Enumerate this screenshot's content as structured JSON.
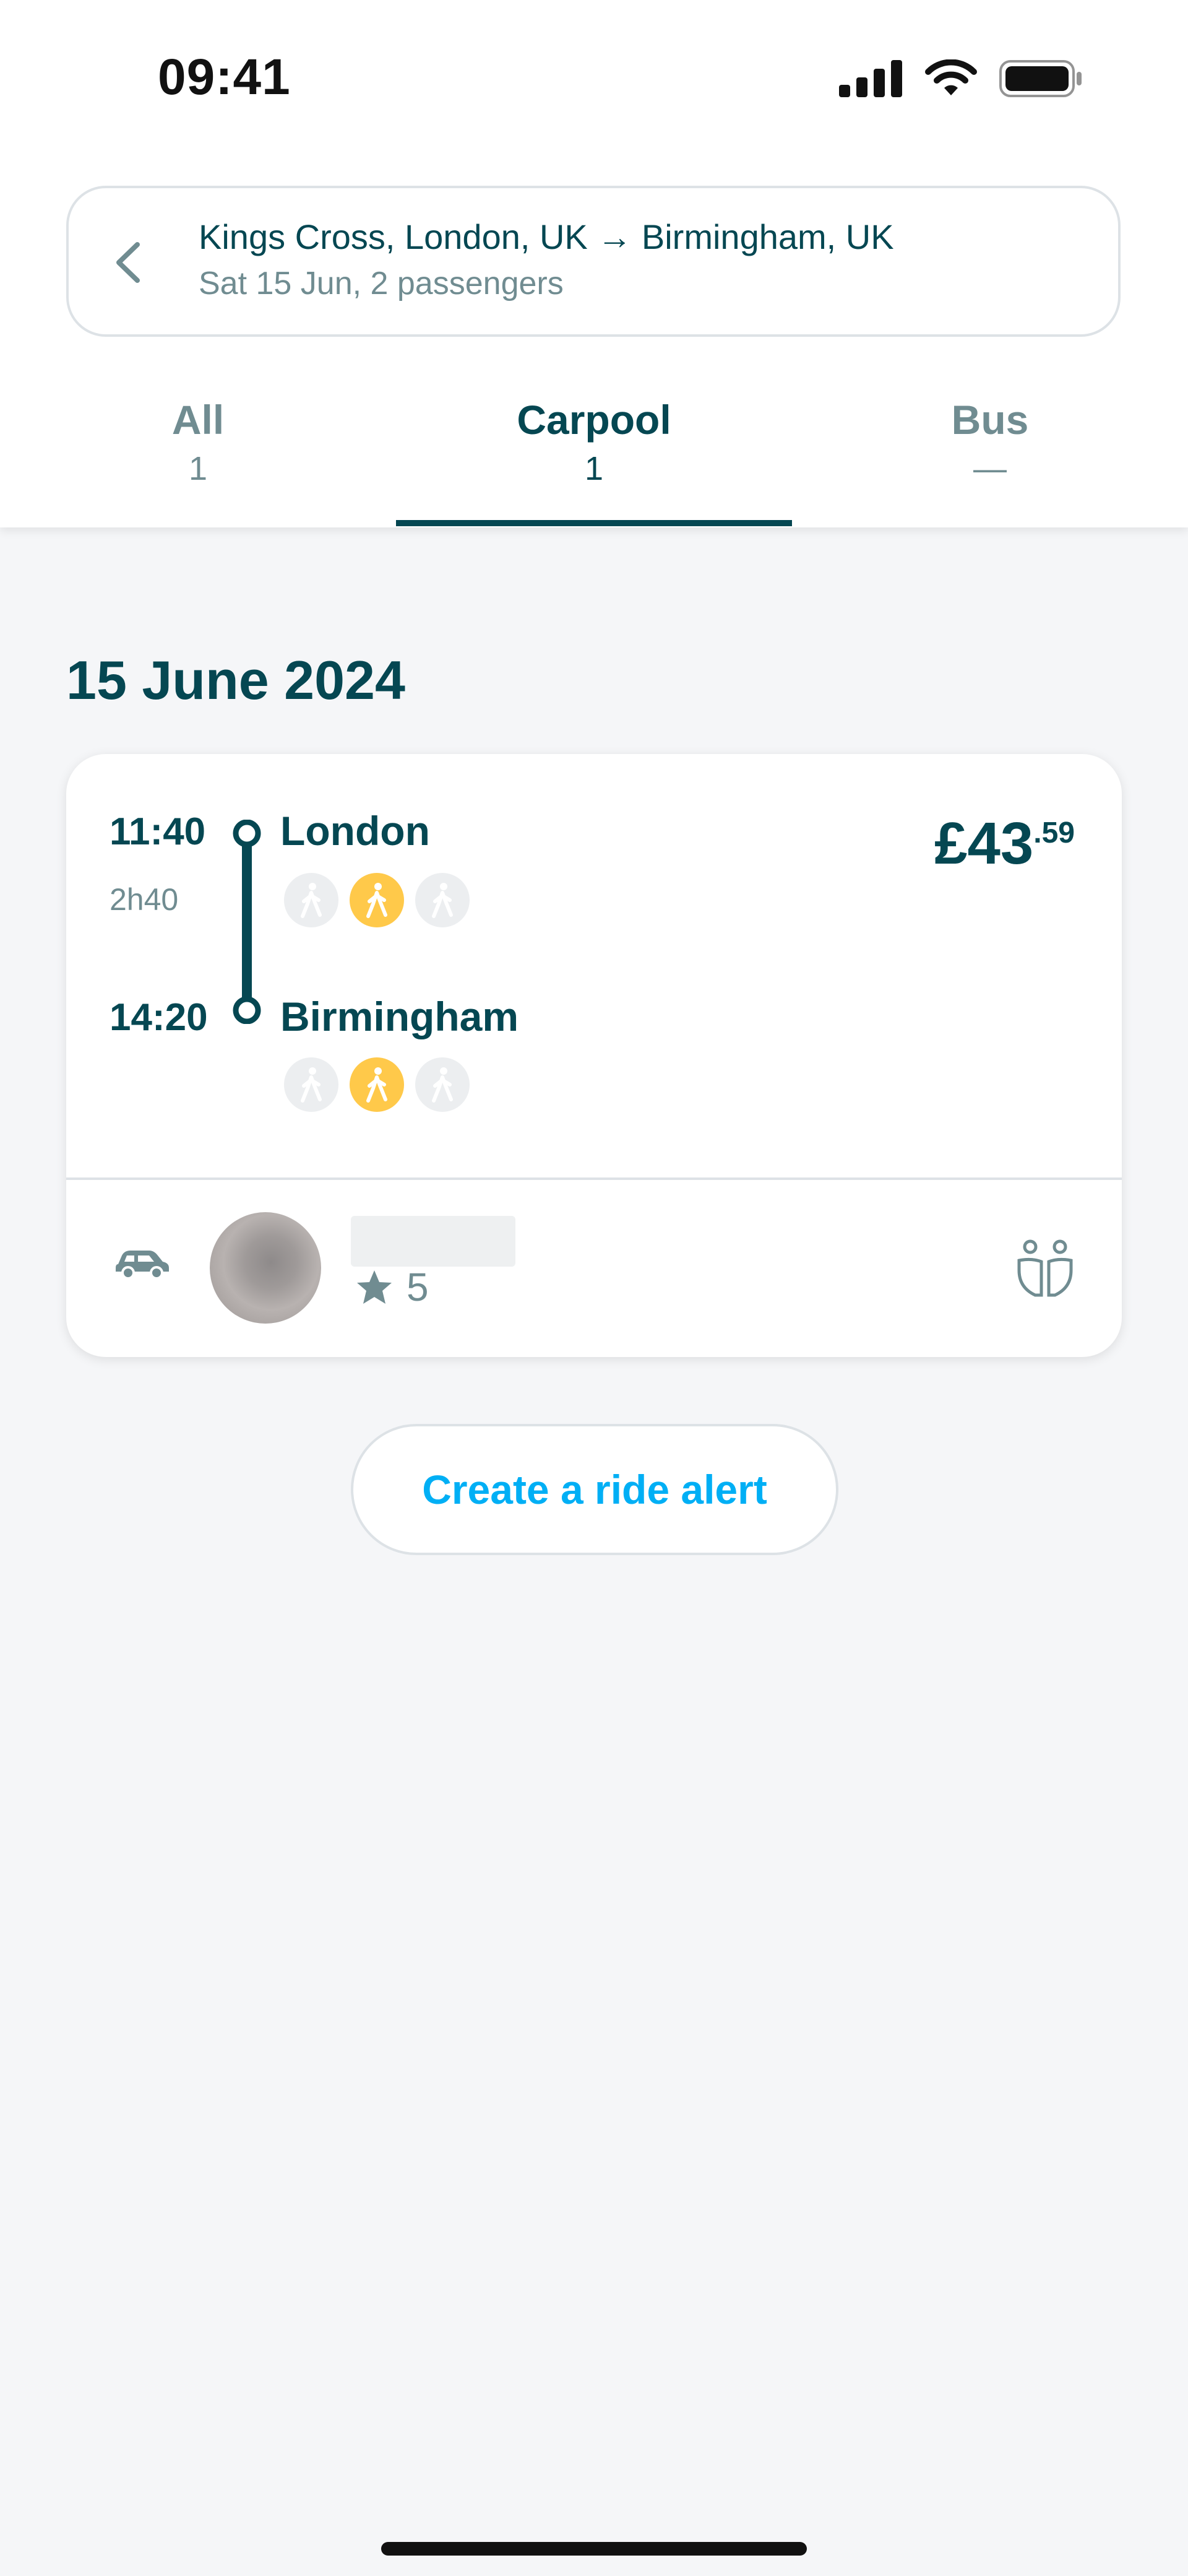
{
  "status_bar": {
    "time": "09:41"
  },
  "search": {
    "route": "Kings Cross, London, UK → Birmingham, UK",
    "details": "Sat 15 Jun, 2 passengers"
  },
  "tabs": [
    {
      "label": "All",
      "count": "1"
    },
    {
      "label": "Carpool",
      "count": "1"
    },
    {
      "label": "Bus",
      "count": "—"
    }
  ],
  "date_heading": "15 June 2024",
  "ride": {
    "departure_time": "11:40",
    "duration": "2h40",
    "arrival_time": "14:20",
    "departure_city": "London",
    "arrival_city": "Birmingham",
    "price_main": "£43",
    "price_cents": ".59",
    "driver_rating": "5",
    "proximity_level_departure": 2,
    "proximity_level_arrival": 2
  },
  "actions": {
    "create_alert": "Create a ride alert"
  },
  "colors": {
    "primary": "#054752",
    "accent": "#00aff5",
    "muted": "#708c91",
    "walk_highlight": "#ffc94a"
  },
  "icons": [
    "back-arrow-icon",
    "car-icon",
    "star-icon",
    "passengers-icon",
    "walking-person-icon",
    "signal-icon",
    "wifi-icon",
    "battery-icon"
  ]
}
